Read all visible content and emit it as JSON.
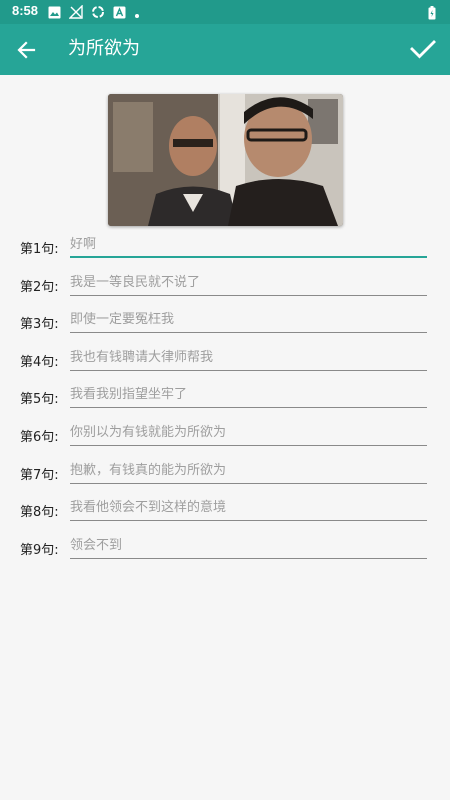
{
  "status_bar": {
    "time": "8:58",
    "icons": [
      "image-icon",
      "signal-off-icon",
      "sync-icon",
      "text-icon",
      "dot-icon",
      "battery-icon"
    ]
  },
  "app_bar": {
    "title": "为所欲为",
    "back_icon": "arrow-left-icon",
    "confirm_icon": "check-icon",
    "background": "#26a597"
  },
  "lines": [
    {
      "label": "第1句:",
      "placeholder": "好啊",
      "focused": true
    },
    {
      "label": "第2句:",
      "placeholder": "我是一等良民就不说了"
    },
    {
      "label": "第3句:",
      "placeholder": "即使一定要冤枉我"
    },
    {
      "label": "第4句:",
      "placeholder": "我也有钱聘请大律师帮我"
    },
    {
      "label": "第5句:",
      "placeholder": "我看我别指望坐牢了"
    },
    {
      "label": "第6句:",
      "placeholder": "你别以为有钱就能为所欲为"
    },
    {
      "label": "第7句:",
      "placeholder": "抱歉，有钱真的能为所欲为"
    },
    {
      "label": "第8句:",
      "placeholder": "我看他领会不到这样的意境"
    },
    {
      "label": "第9句:",
      "placeholder": "领会不到"
    }
  ],
  "colors": {
    "accent": "#26a597",
    "status_bar": "#219a8b"
  }
}
